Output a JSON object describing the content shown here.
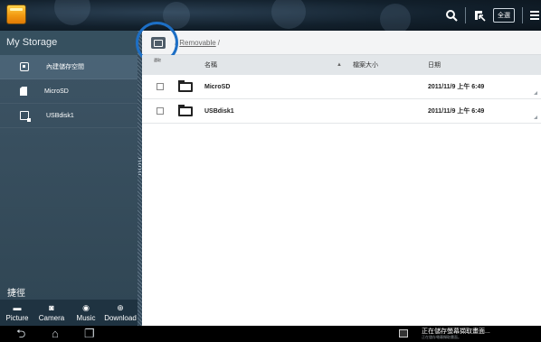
{
  "topbar": {
    "select_all_label": "全選",
    "icons": [
      "search-icon",
      "copy-to-icon",
      "select-all-icon",
      "overflow-menu-icon"
    ]
  },
  "sidebar": {
    "title": "My Storage",
    "items": [
      {
        "label": "內建儲存空間",
        "icon": "internal-storage-icon"
      },
      {
        "label": "MicroSD",
        "icon": "sd-card-icon"
      },
      {
        "label": "USBdisk1",
        "icon": "usb-disk-icon"
      }
    ],
    "shortcut_title": "捷徑",
    "shortcuts": [
      {
        "label": "Picture",
        "icon": "picture-icon"
      },
      {
        "label": "Camera",
        "icon": "camera-icon"
      },
      {
        "label": "Music",
        "icon": "music-icon"
      },
      {
        "label": "Download",
        "icon": "download-icon"
      }
    ]
  },
  "main": {
    "breadcrumb": {
      "sep": "/",
      "link": "Removable",
      "tail": "/"
    },
    "columns": {
      "sort_tag": "選取",
      "name": "名稱",
      "size": "檔案大小",
      "date": "日期"
    },
    "rows": [
      {
        "name": "MicroSD",
        "date": "2011/11/9 上午 6:49"
      },
      {
        "name": "USBdisk1",
        "date": "2011/11/9 上午 6:49"
      }
    ]
  },
  "statusbar": {
    "notification_title": "正在儲存螢幕擷取畫面...",
    "notification_sub": "正在儲存螢幕擷取畫面。"
  },
  "colors": {
    "accent_ring": "#1d6fc5",
    "sidebar_bg": "#3e5566",
    "topbar_bg": "#12202c"
  }
}
